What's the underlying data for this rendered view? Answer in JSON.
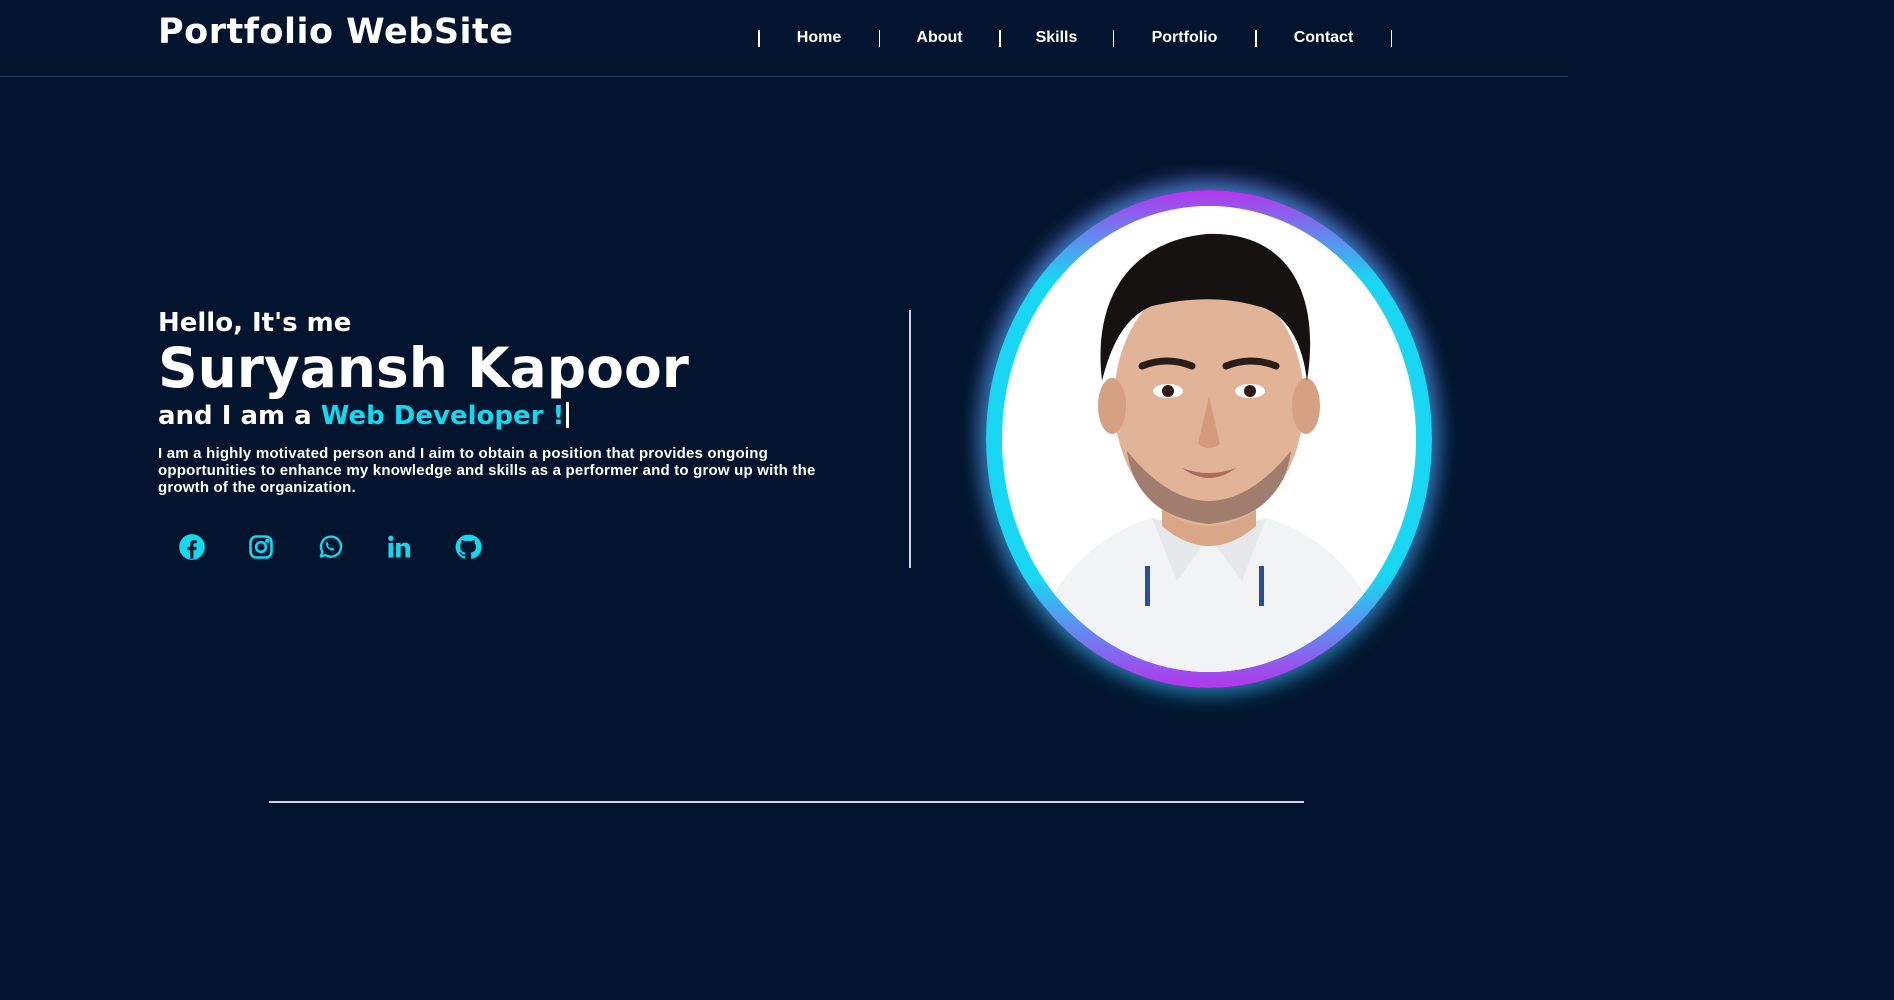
{
  "header": {
    "logo": "Portfolio WebSite",
    "nav": [
      {
        "label": "Home"
      },
      {
        "label": "About"
      },
      {
        "label": "Skills"
      },
      {
        "label": "Portfolio"
      },
      {
        "label": "Contact"
      }
    ]
  },
  "hero": {
    "greeting": "Hello, It's me",
    "name": "Suryansh Kapoor",
    "role_prefix": "and I am a",
    "role_highlight": "Web Developer !",
    "bio": "I am a highly motivated person and I aim to obtain a position that provides ongoing opportunities to enhance my knowledge and skills as a performer and to grow up with the growth of the organization.",
    "socials": [
      {
        "icon": "facebook-icon"
      },
      {
        "icon": "instagram-icon"
      },
      {
        "icon": "whatsapp-icon"
      },
      {
        "icon": "linkedin-icon"
      },
      {
        "icon": "github-icon"
      }
    ]
  },
  "colors": {
    "background": "#03152e",
    "accent": "#11d9ef",
    "ring_top": "#b535ec",
    "text": "#ffffff"
  }
}
